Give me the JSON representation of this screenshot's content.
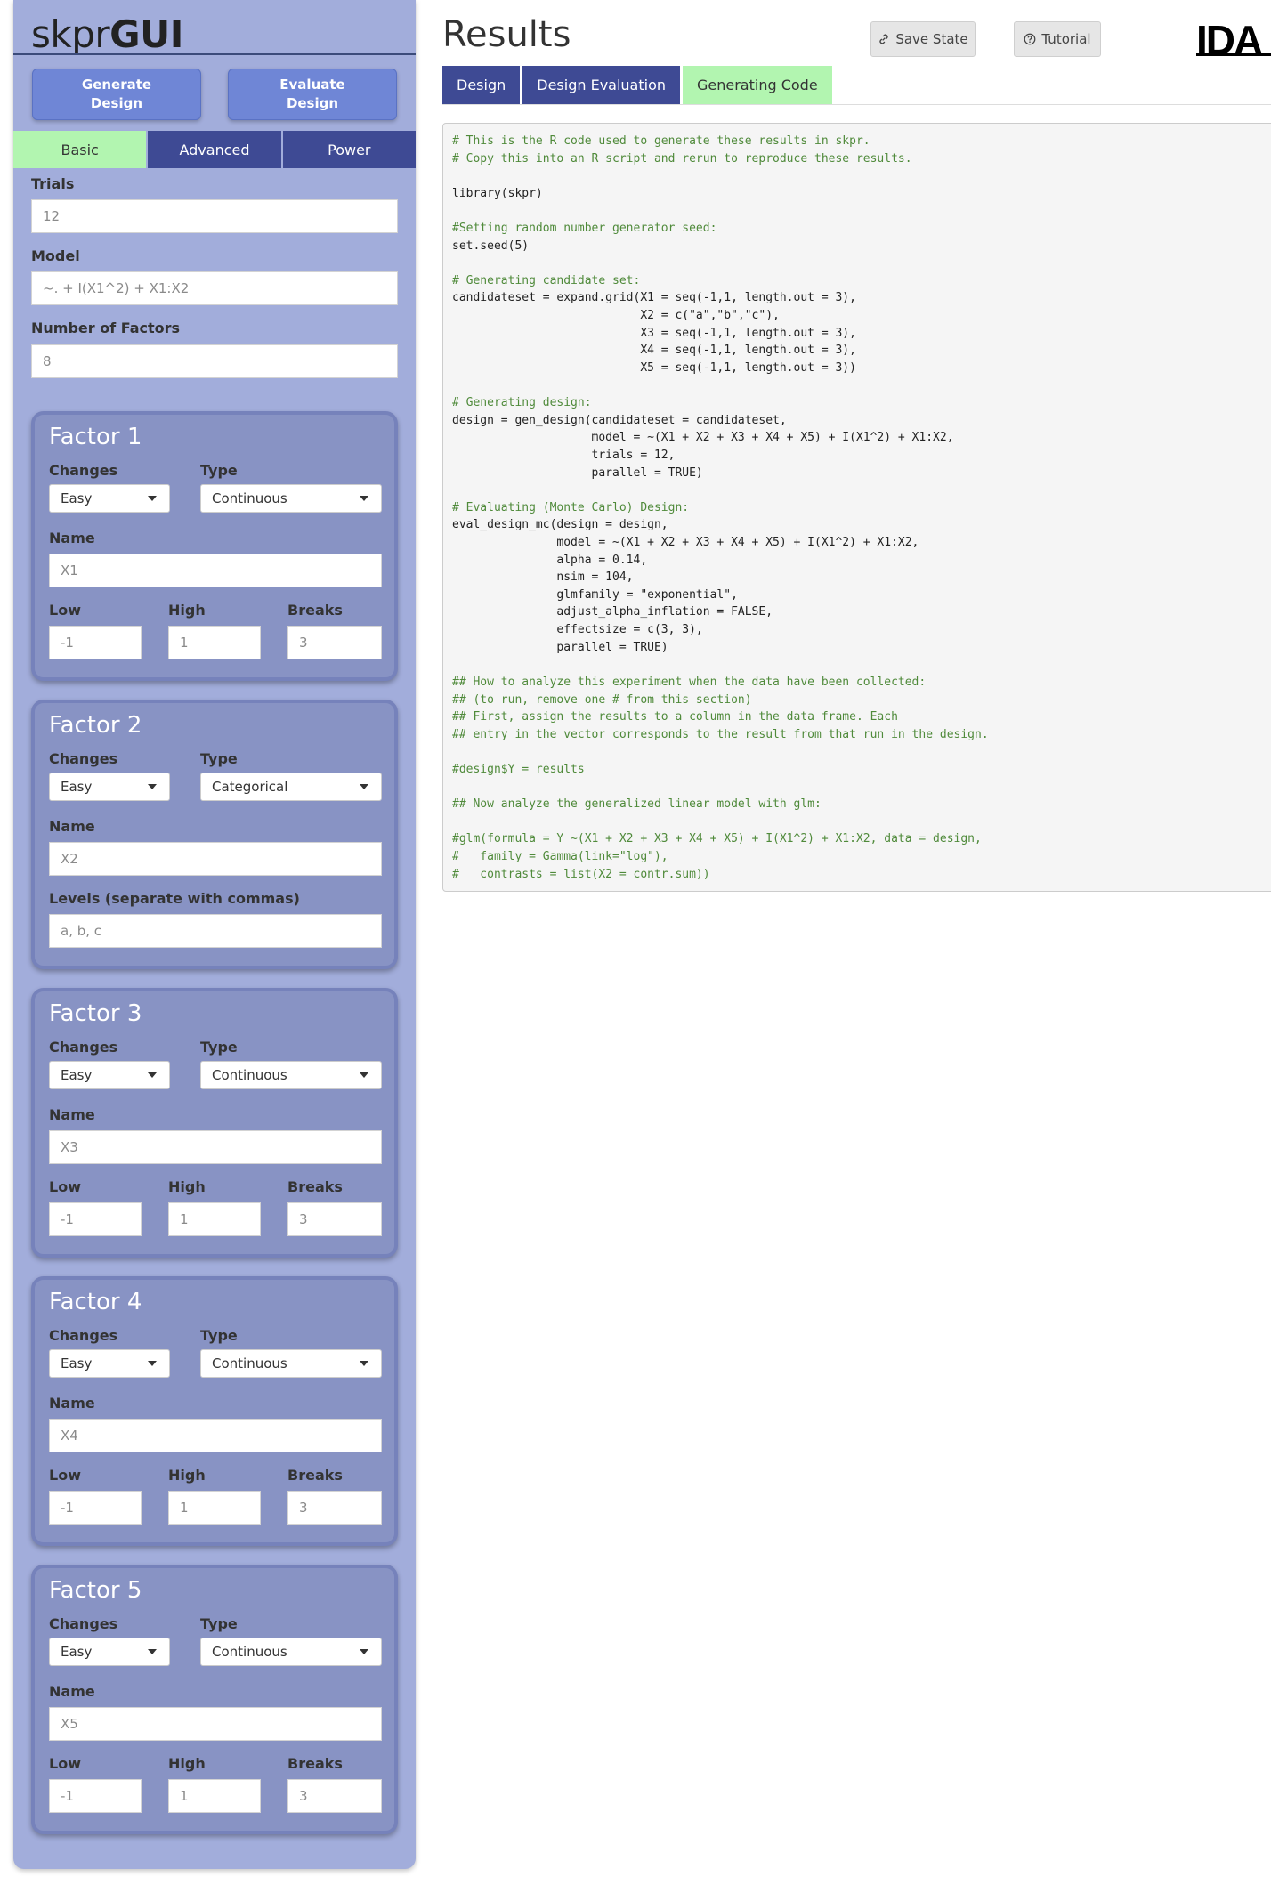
{
  "sidebar": {
    "brand_light": "skpr",
    "brand_bold": "GUI",
    "generate_button": "Generate\nDesign",
    "evaluate_button": "Evaluate\nDesign",
    "tabs": [
      {
        "label": "Basic",
        "active": true
      },
      {
        "label": "Advanced",
        "active": false
      },
      {
        "label": "Power",
        "active": false
      }
    ],
    "trials": {
      "label": "Trials",
      "value": "12"
    },
    "model": {
      "label": "Model",
      "value": "~. + I(X1^2) + X1:X2"
    },
    "num_factors": {
      "label": "Number of Factors",
      "value": "8"
    },
    "labels": {
      "changes": "Changes",
      "type": "Type",
      "name": "Name",
      "low": "Low",
      "high": "High",
      "breaks": "Breaks",
      "levels": "Levels (separate with commas)"
    },
    "factors": [
      {
        "title": "Factor 1",
        "changes": "Easy",
        "type": "Continuous",
        "name": "X1",
        "low": "-1",
        "high": "1",
        "breaks": "3"
      },
      {
        "title": "Factor 2",
        "changes": "Easy",
        "type": "Categorical",
        "name": "X2",
        "levels": "a, b, c"
      },
      {
        "title": "Factor 3",
        "changes": "Easy",
        "type": "Continuous",
        "name": "X3",
        "low": "-1",
        "high": "1",
        "breaks": "3"
      },
      {
        "title": "Factor 4",
        "changes": "Easy",
        "type": "Continuous",
        "name": "X4",
        "low": "-1",
        "high": "1",
        "breaks": "3"
      },
      {
        "title": "Factor 5",
        "changes": "Easy",
        "type": "Continuous",
        "name": "X5",
        "low": "-1",
        "high": "1",
        "breaks": "3"
      }
    ]
  },
  "main": {
    "title": "Results",
    "save_state": "Save State",
    "tutorial": "Tutorial",
    "logo": "IDA",
    "tabs": [
      {
        "label": "Design",
        "active": false
      },
      {
        "label": "Design Evaluation",
        "active": false
      },
      {
        "label": "Generating Code",
        "active": true
      }
    ],
    "code_lines": [
      {
        "text": "# This is the R code used to generate these results in skpr.",
        "kind": "comment"
      },
      {
        "text": "# Copy this into an R script and rerun to reproduce these results.",
        "kind": "comment"
      },
      {
        "text": "",
        "kind": "code"
      },
      {
        "text": "library(skpr)",
        "kind": "code"
      },
      {
        "text": "",
        "kind": "code"
      },
      {
        "text": "#Setting random number generator seed:",
        "kind": "comment"
      },
      {
        "text": "set.seed(5)",
        "kind": "code"
      },
      {
        "text": "",
        "kind": "code"
      },
      {
        "text": "# Generating candidate set:",
        "kind": "comment"
      },
      {
        "text": "candidateset = expand.grid(X1 = seq(-1,1, length.out = 3),",
        "kind": "code"
      },
      {
        "text": "                           X2 = c(\"a\",\"b\",\"c\"),",
        "kind": "code"
      },
      {
        "text": "                           X3 = seq(-1,1, length.out = 3),",
        "kind": "code"
      },
      {
        "text": "                           X4 = seq(-1,1, length.out = 3),",
        "kind": "code"
      },
      {
        "text": "                           X5 = seq(-1,1, length.out = 3))",
        "kind": "code"
      },
      {
        "text": "",
        "kind": "code"
      },
      {
        "text": "# Generating design:",
        "kind": "comment"
      },
      {
        "text": "design = gen_design(candidateset = candidateset,",
        "kind": "code"
      },
      {
        "text": "                    model = ~(X1 + X2 + X3 + X4 + X5) + I(X1^2) + X1:X2,",
        "kind": "code"
      },
      {
        "text": "                    trials = 12,",
        "kind": "code"
      },
      {
        "text": "                    parallel = TRUE)",
        "kind": "code"
      },
      {
        "text": "",
        "kind": "code"
      },
      {
        "text": "# Evaluating (Monte Carlo) Design:",
        "kind": "comment"
      },
      {
        "text": "eval_design_mc(design = design,",
        "kind": "code"
      },
      {
        "text": "               model = ~(X1 + X2 + X3 + X4 + X5) + I(X1^2) + X1:X2,",
        "kind": "code"
      },
      {
        "text": "               alpha = 0.14,",
        "kind": "code"
      },
      {
        "text": "               nsim = 104,",
        "kind": "code"
      },
      {
        "text": "               glmfamily = \"exponential\",",
        "kind": "code"
      },
      {
        "text": "               adjust_alpha_inflation = FALSE,",
        "kind": "code"
      },
      {
        "text": "               effectsize = c(3, 3),",
        "kind": "code"
      },
      {
        "text": "               parallel = TRUE)",
        "kind": "code"
      },
      {
        "text": "",
        "kind": "code"
      },
      {
        "text": "## How to analyze this experiment when the data have been collected:",
        "kind": "comment"
      },
      {
        "text": "## (to run, remove one # from this section)",
        "kind": "comment"
      },
      {
        "text": "## First, assign the results to a column in the data frame. Each",
        "kind": "comment"
      },
      {
        "text": "## entry in the vector corresponds to the result from that run in the design.",
        "kind": "comment"
      },
      {
        "text": "",
        "kind": "code"
      },
      {
        "text": "#design$Y = results",
        "kind": "comment"
      },
      {
        "text": "",
        "kind": "code"
      },
      {
        "text": "## Now analyze the generalized linear model with glm:",
        "kind": "comment"
      },
      {
        "text": "",
        "kind": "code"
      },
      {
        "text": "#glm(formula = Y ~(X1 + X2 + X3 + X4 + X5) + I(X1^2) + X1:X2, data = design,",
        "kind": "comment"
      },
      {
        "text": "#   family = Gamma(link=\"log\"),",
        "kind": "comment"
      },
      {
        "text": "#   contrasts = list(X2 = contr.sum))",
        "kind": "comment"
      }
    ]
  }
}
